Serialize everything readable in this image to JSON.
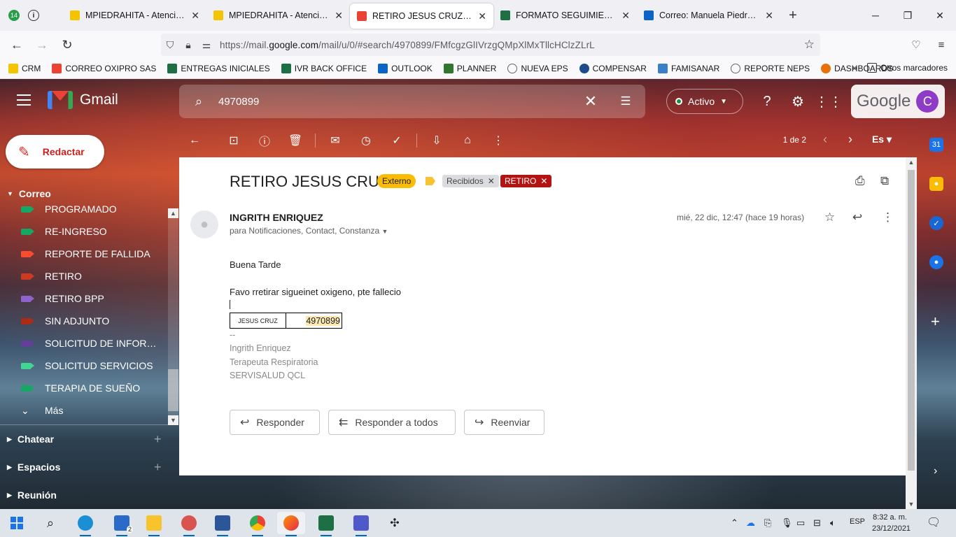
{
  "browser": {
    "tab_count_badge": "14",
    "tabs": [
      {
        "label": "MPIEDRAHITA - Atención al U",
        "color": "#f5c400"
      },
      {
        "label": "MPIEDRAHITA - Atención al U",
        "color": "#f5c400"
      },
      {
        "label": "RETIRO JESUS CRUZ - coordin",
        "color": "#ea4335"
      },
      {
        "label": "FORMATO SEGUIMIENTO GD.",
        "color": "#1d7044"
      },
      {
        "label": "Correo: Manuela Piedrahita -",
        "color": "#0a64c7"
      }
    ],
    "url_prefix": "https://mail.",
    "url_domain": "google.com",
    "url_rest": "/mail/u/0/#search/4970899/FMfcgzGlIVrzgQMpXlMxTllcHClzZLrL",
    "bookmarks": [
      {
        "label": "CRM",
        "color": "#f5c400"
      },
      {
        "label": "CORREO OXIPRO SAS",
        "color": "#ea4335"
      },
      {
        "label": "ENTREGAS INICIALES",
        "color": "#1d7044"
      },
      {
        "label": "IVR BACK OFFICE",
        "color": "#1d7044"
      },
      {
        "label": "OUTLOOK",
        "color": "#0a64c7"
      },
      {
        "label": "PLANNER",
        "color": "#31752f"
      },
      {
        "label": "NUEVA EPS",
        "color": "#666666"
      },
      {
        "label": "COMPENSAR",
        "color": "#1e4c8a"
      },
      {
        "label": "FAMISANAR",
        "color": "#3b7fc4"
      },
      {
        "label": "REPORTE NEPS",
        "color": "#666666"
      },
      {
        "label": "DASHBOARDS",
        "color": "#e8710a"
      }
    ],
    "other_bookmarks": "Otros marcadores"
  },
  "gmail": {
    "app_name": "Gmail",
    "search_value": "4970899",
    "status": "Activo",
    "google_text": "Google",
    "avatar_letter": "C",
    "compose_label": "Redactar",
    "section_mail": "Correo",
    "labels": [
      {
        "name": "PROGRAMADO",
        "color": "#16a765"
      },
      {
        "name": "RE-INGRESO",
        "color": "#16a765"
      },
      {
        "name": "REPORTE DE FALLIDA",
        "color": "#fb4c2f"
      },
      {
        "name": "RETIRO",
        "color": "#cc3a21"
      },
      {
        "name": "RETIRO BPP",
        "color": "#8e63ce"
      },
      {
        "name": "SIN ADJUNTO",
        "color": "#ac2b16"
      },
      {
        "name": "SOLICITUD DE INFORM...",
        "color": "#653e9b"
      },
      {
        "name": "SOLICITUD SERVICIOS",
        "color": "#43d692"
      },
      {
        "name": "TERAPIA DE SUEÑO",
        "color": "#16a765"
      }
    ],
    "more_label": "Más",
    "section_chat": "Chatear",
    "section_spaces": "Espacios",
    "section_meet": "Reunión",
    "pager_text": "1 de 2",
    "lang": "Es"
  },
  "message": {
    "subject": "RETIRO JESUS CRUZ",
    "external_chip": "Externo",
    "label_inbox": "Recibidos",
    "label_retiro": "RETIRO",
    "sender": "INGRITH ENRIQUEZ",
    "recipients": "para Notificaciones, Contact, Constanza",
    "date": "mié, 22 dic, 12:47 (hace 19 horas)",
    "greeting": "Buena Tarde",
    "body": "Favo rretirar sigueinet oxigeno, pte fallecio",
    "table_name": "JESUS CRUZ",
    "table_id": "4970899",
    "sig_sep": "--",
    "sig_name": "Ingrith Enriquez",
    "sig_role": "Terapeuta Respiratoria",
    "sig_company": "SERVISALUD QCL",
    "reply": "Responder",
    "reply_all": "Responder a todos",
    "forward": "Reenviar"
  },
  "taskbar": {
    "lang": "ESP",
    "time": "8:32 a. m.",
    "date": "23/12/2021",
    "mail_badge": "2"
  }
}
